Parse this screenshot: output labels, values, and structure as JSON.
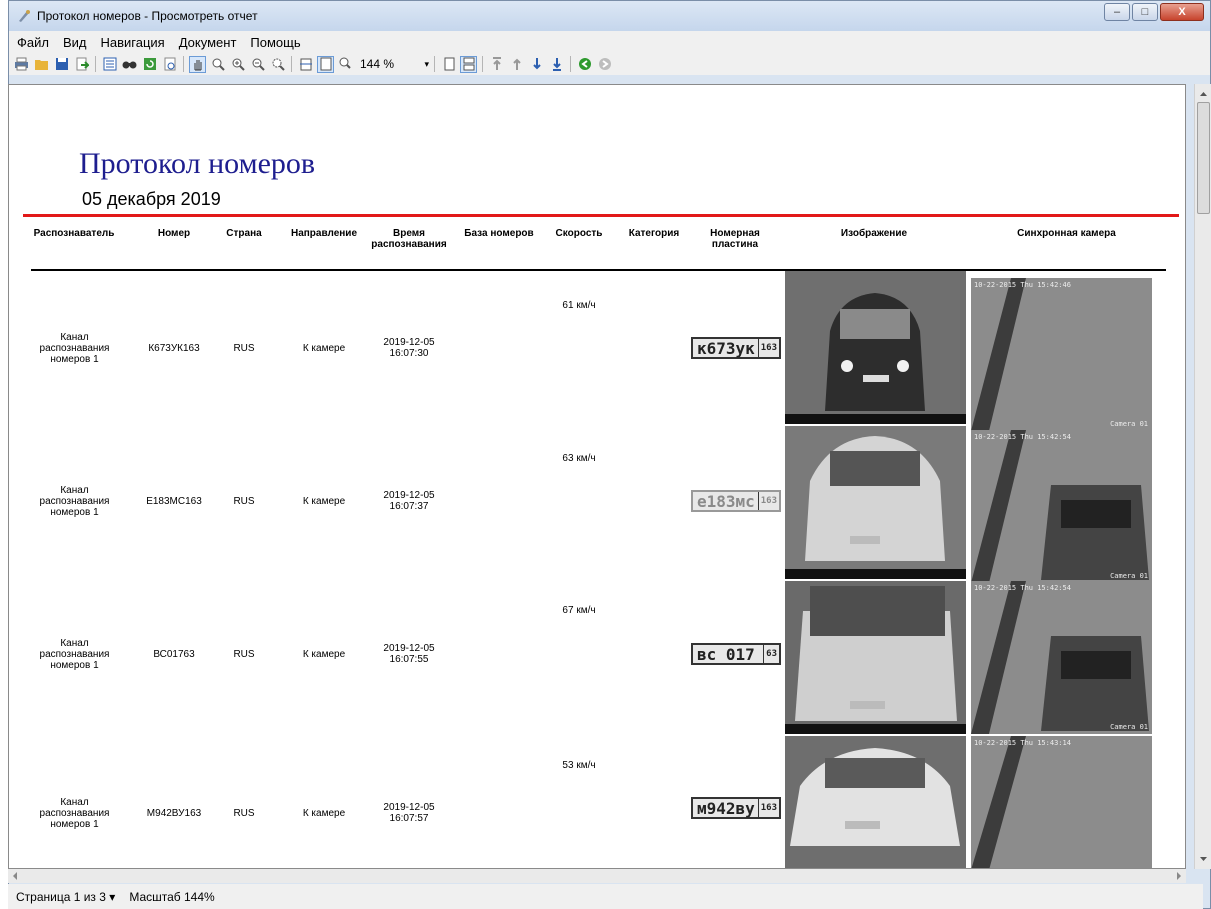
{
  "window": {
    "title": "Протокол номеров - Просмотреть отчет",
    "min_glyph": "–",
    "max_glyph": "□",
    "close_glyph": "X"
  },
  "menu": [
    "Файл",
    "Вид",
    "Навигация",
    "Документ",
    "Помощь"
  ],
  "toolbar": {
    "zoom_value": "144 %",
    "zoom_arrow": "▾"
  },
  "report": {
    "title": "Протокол номеров",
    "date": "05 декабря 2019",
    "columns": [
      "Распознаватель",
      "Номер",
      "Страна",
      "Направление",
      "Время распознавания",
      "База номеров",
      "Скорость",
      "Категория",
      "Номерная пластина",
      "Изображение",
      "Синхронная камера"
    ],
    "rows": [
      {
        "recognizer": "Канал распознавания номеров 1",
        "number": "К673УК163",
        "country": "RUS",
        "direction": "К камере",
        "time": "2019-12-05 16:07:30",
        "speed": "61 км/ч",
        "plate_main": "к673ук",
        "plate_reg": "163",
        "sync_ts": "10-22-2015 Thu 15:42:46",
        "cam": "Camera 01"
      },
      {
        "recognizer": "Канал распознавания номеров 1",
        "number": "Е183МС163",
        "country": "RUS",
        "direction": "К камере",
        "time": "2019-12-05 16:07:37",
        "speed": "63 км/ч",
        "plate_main": "е183мс",
        "plate_reg": "163",
        "sync_ts": "10-22-2015 Thu 15:42:54",
        "cam": "Camera 01"
      },
      {
        "recognizer": "Канал распознавания номеров 1",
        "number": "ВС01763",
        "country": "RUS",
        "direction": "К камере",
        "time": "2019-12-05 16:07:55",
        "speed": "67 км/ч",
        "plate_main": "вс 017",
        "plate_reg": "63",
        "sync_ts": "10-22-2015 Thu 15:42:54",
        "cam": "Camera 01"
      },
      {
        "recognizer": "Канал распознавания номеров 1",
        "number": "М942ВУ163",
        "country": "RUS",
        "direction": "К камере",
        "time": "2019-12-05 16:07:57",
        "speed": "53 км/ч",
        "plate_main": "м942ву",
        "plate_reg": "163",
        "sync_ts": "10-22-2015 Thu 15:43:14",
        "cam": ""
      }
    ]
  },
  "status": {
    "page": "Страница 1 из 3",
    "page_arrow": "▾",
    "zoom": "Масштаб 144%"
  },
  "colors": {
    "title": "#1e1e8f",
    "rule": "#e21818"
  }
}
